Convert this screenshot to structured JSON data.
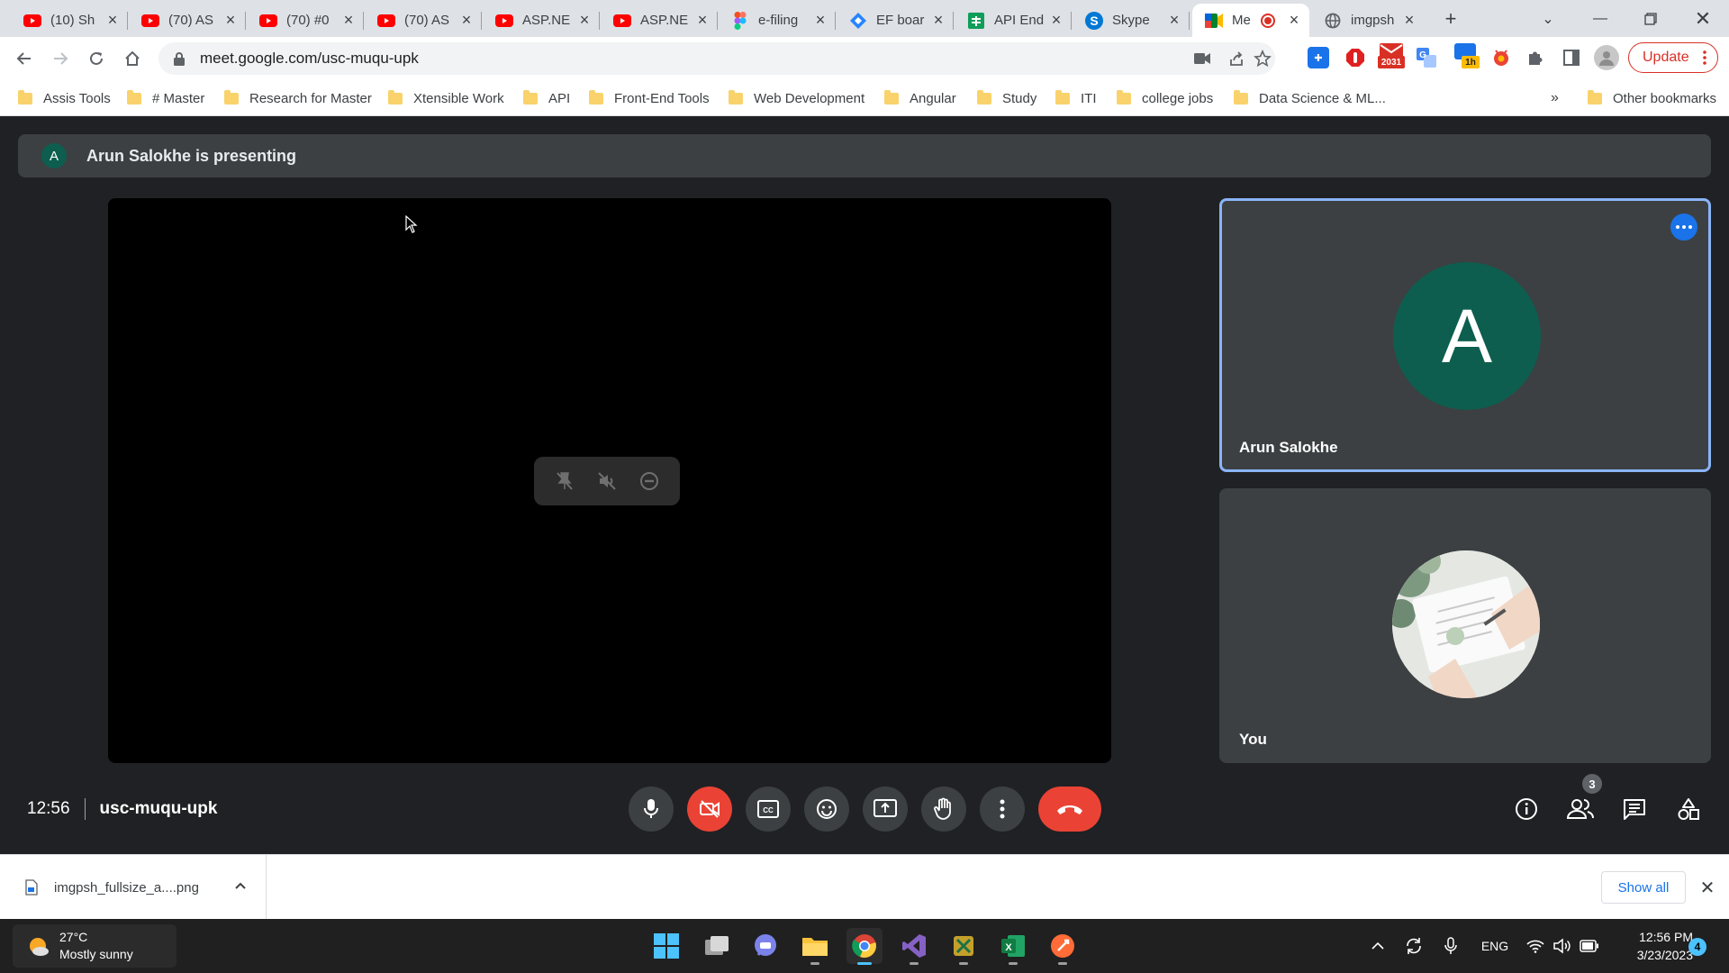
{
  "browser": {
    "tabs": [
      {
        "title": "(10) Sh",
        "favicon": "youtube-icon"
      },
      {
        "title": "(70) AS",
        "favicon": "youtube-icon"
      },
      {
        "title": "(70) #0",
        "favicon": "youtube-icon"
      },
      {
        "title": "(70) AS",
        "favicon": "youtube-icon"
      },
      {
        "title": "ASP.NE",
        "favicon": "youtube-icon"
      },
      {
        "title": "ASP.NE",
        "favicon": "youtube-icon"
      },
      {
        "title": "e-filing",
        "favicon": "figma-icon"
      },
      {
        "title": "EF boar",
        "favicon": "jira-icon"
      },
      {
        "title": "API End",
        "favicon": "sheets-icon"
      },
      {
        "title": "Skype",
        "favicon": "skype-icon"
      },
      {
        "title": "Me",
        "favicon": "meet-icon",
        "active": true
      },
      {
        "title": "imgpsh",
        "favicon": "globe-icon"
      }
    ],
    "url": "meet.google.com/usc-muqu-upk",
    "update_label": "Update",
    "extension_badges": {
      "mail_count": "2031",
      "timer": "1h"
    },
    "bookmarks": [
      "Assis Tools",
      "# Master",
      "Research for Master",
      "Xtensible Work",
      "API",
      "Front-End Tools",
      "Web Development",
      "Angular",
      "Study",
      "ITI",
      "college jobs",
      "Data Science & ML..."
    ],
    "bookmarks_overflow": "»",
    "other_bookmarks": "Other bookmarks"
  },
  "meet": {
    "presenting_banner": "Arun Salokhe is presenting",
    "presenter_initial": "A",
    "participants": [
      {
        "name": "Arun Salokhe",
        "initial": "A",
        "avatar_color": "#0d5e4e",
        "speaking_highlight": true
      },
      {
        "name": "You",
        "avatar": "photo"
      }
    ],
    "time": "12:56",
    "meeting_code": "usc-muqu-upk",
    "people_count": "3",
    "colors": {
      "accent": "#8ab4f8",
      "end_call": "#ea4335",
      "background": "#202124",
      "tile": "#3c4043"
    }
  },
  "download_shelf": {
    "file_name": "imgpsh_fullsize_a....png",
    "show_all_label": "Show all"
  },
  "taskbar": {
    "weather_temp": "27°C",
    "weather_desc": "Mostly sunny",
    "language": "ENG",
    "time": "12:56 PM",
    "date": "3/23/2023",
    "notification_count": "4"
  }
}
